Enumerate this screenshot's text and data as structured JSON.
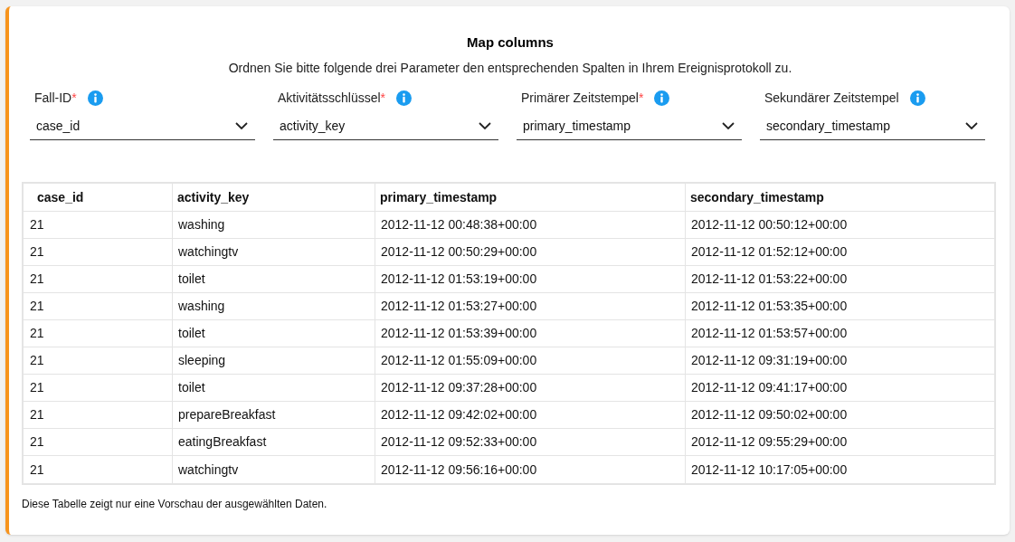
{
  "title": "Map columns",
  "instruction": "Ordnen Sie bitte folgende drei Parameter den entsprechenden Spalten in Ihrem Ereignisprotokoll zu.",
  "fields": [
    {
      "label": "Fall-ID",
      "required_mark": "*",
      "value": "case_id"
    },
    {
      "label": "Aktivitätsschlüssel",
      "required_mark": "*",
      "value": "activity_key"
    },
    {
      "label": "Primärer Zeitstempel",
      "required_mark": "*",
      "value": "primary_timestamp"
    },
    {
      "label": "Sekundärer Zeitstempel",
      "value": "secondary_timestamp"
    }
  ],
  "table": {
    "columns": [
      "case_id",
      "activity_key",
      "primary_timestamp",
      "secondary_timestamp"
    ],
    "rows": [
      [
        "21",
        "washing",
        "2012-11-12 00:48:38+00:00",
        "2012-11-12 00:50:12+00:00"
      ],
      [
        "21",
        "watchingtv",
        "2012-11-12 00:50:29+00:00",
        "2012-11-12 01:52:12+00:00"
      ],
      [
        "21",
        "toilet",
        "2012-11-12 01:53:19+00:00",
        "2012-11-12 01:53:22+00:00"
      ],
      [
        "21",
        "washing",
        "2012-11-12 01:53:27+00:00",
        "2012-11-12 01:53:35+00:00"
      ],
      [
        "21",
        "toilet",
        "2012-11-12 01:53:39+00:00",
        "2012-11-12 01:53:57+00:00"
      ],
      [
        "21",
        "sleeping",
        "2012-11-12 01:55:09+00:00",
        "2012-11-12 09:31:19+00:00"
      ],
      [
        "21",
        "toilet",
        "2012-11-12 09:37:28+00:00",
        "2012-11-12 09:41:17+00:00"
      ],
      [
        "21",
        "prepareBreakfast",
        "2012-11-12 09:42:02+00:00",
        "2012-11-12 09:50:02+00:00"
      ],
      [
        "21",
        "eatingBreakfast",
        "2012-11-12 09:52:33+00:00",
        "2012-11-12 09:55:29+00:00"
      ],
      [
        "21",
        "watchingtv",
        "2012-11-12 09:56:16+00:00",
        "2012-11-12 10:17:05+00:00"
      ]
    ]
  },
  "footnote": "Diese Tabelle zeigt nur eine Vorschau der ausgewählten Daten."
}
